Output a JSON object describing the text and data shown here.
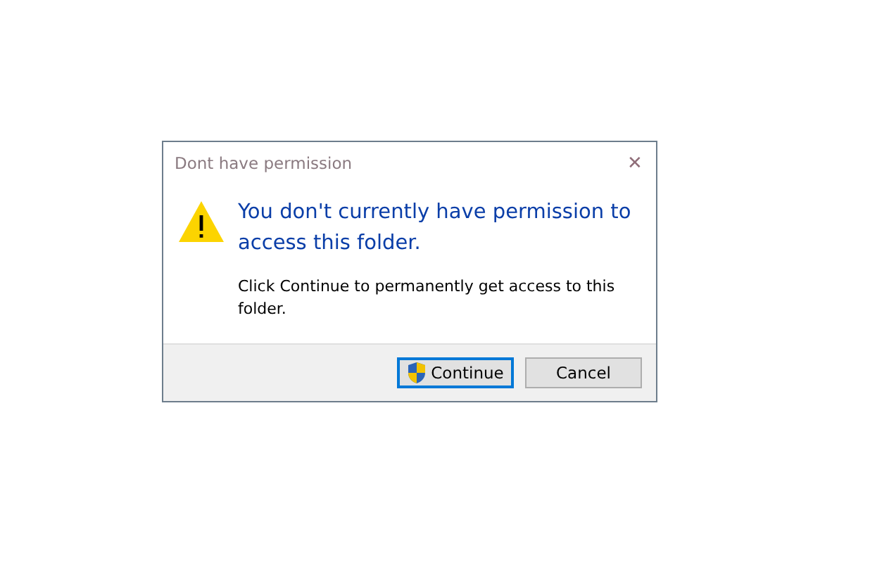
{
  "window": {
    "title": "Dont have permission",
    "close_glyph": "✕"
  },
  "message": {
    "heading": "You don't currently have permission to access this folder.",
    "detail": "Click Continue to permanently get access to this folder."
  },
  "buttons": [
    {
      "label": "Continue",
      "default": true,
      "shield": true
    },
    {
      "label": "Cancel",
      "default": false,
      "shield": false
    }
  ]
}
